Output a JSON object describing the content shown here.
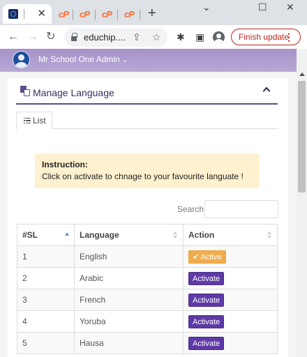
{
  "browser": {
    "tabs": [
      {
        "icon": "educhip-favicon",
        "title": "I",
        "active": true
      },
      {
        "icon": "cpanel-icon"
      },
      {
        "icon": "cpanel-icon"
      },
      {
        "icon": "cpanel-icon"
      },
      {
        "icon": "cpanel-icon"
      }
    ],
    "url": "educhip....",
    "finish_update_label": "Finish update",
    "icons": {
      "back": "←",
      "forward": "→",
      "reload": "↻",
      "share": "⇪",
      "bookmark": "☆",
      "extensions": "✱",
      "sidepanel": "▣",
      "menu": "⋮",
      "new_tab": "+",
      "minimize": "⌄",
      "maximize": "☐",
      "close": "✕"
    }
  },
  "header": {
    "admin_name": "Mr School One Admin",
    "caret": "⌄"
  },
  "card": {
    "title": "Manage Language",
    "tab_list_label": "List",
    "instruction_heading": "Instruction:",
    "instruction_text": "Click on activate to chnage to your favourite languate !",
    "search_label": "Search:",
    "search_value": ""
  },
  "table": {
    "columns": [
      "#SL",
      "Language",
      "Action"
    ],
    "rows": [
      {
        "sl": "1",
        "language": "English",
        "action": "✔ Active",
        "status": "active"
      },
      {
        "sl": "2",
        "language": "Arabic",
        "action": "Activate",
        "status": "inactive"
      },
      {
        "sl": "3",
        "language": "French",
        "action": "Activate",
        "status": "inactive"
      },
      {
        "sl": "4",
        "language": "Yoruba",
        "action": "Activate",
        "status": "inactive"
      },
      {
        "sl": "5",
        "language": "Hausa",
        "action": "Activate",
        "status": "inactive"
      }
    ]
  },
  "colors": {
    "header_purple": "#b7a8d4",
    "accent_purple": "#5e3aa6",
    "active_orange": "#f0ad4e",
    "instruction_bg": "#fdf1cf",
    "finish_update_red": "#c5221f"
  }
}
